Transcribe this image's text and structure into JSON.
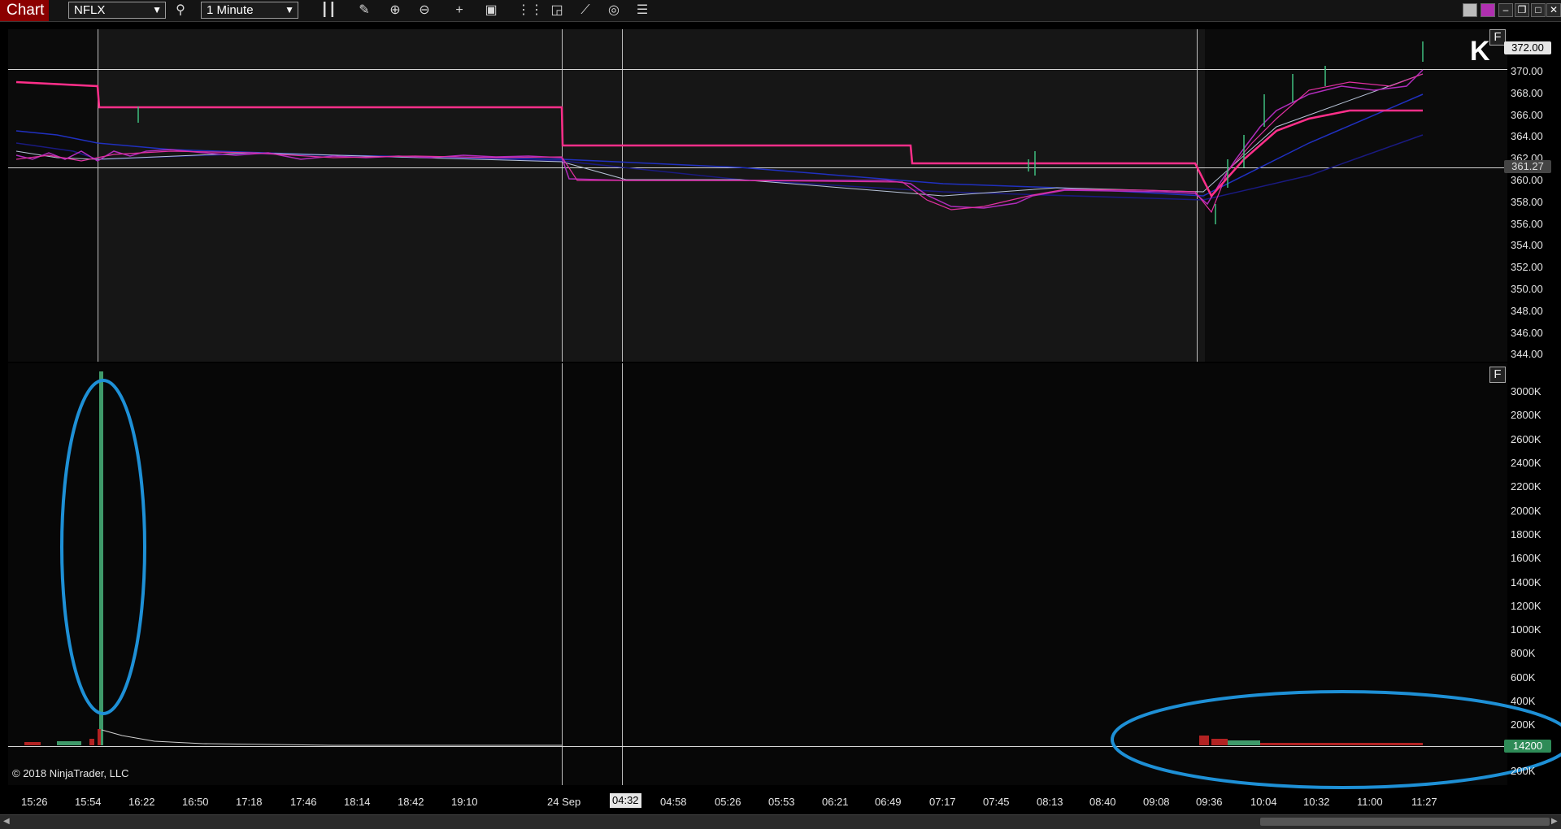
{
  "toolbar": {
    "app_title": "Chart",
    "instrument": "NFLX",
    "interval": "1 Minute",
    "icons": [
      "search-icon",
      "bar-chart-icon",
      "pencil-icon",
      "zoom-in-icon",
      "zoom-out-icon",
      "crosshair-icon",
      "properties-icon",
      "data-box-icon",
      "drawing-tools-icon",
      "strategy-icon",
      "indicator-icon",
      "menu-icon"
    ]
  },
  "window_controls": [
    "color-swatch-gray",
    "color-swatch-purple",
    "minimize",
    "restore",
    "maximize",
    "close"
  ],
  "panels": {
    "price": {
      "f_button": "F",
      "y_ticks": [
        "370.00",
        "368.00",
        "366.00",
        "364.00",
        "362.00",
        "360.00",
        "358.00",
        "356.00",
        "354.00",
        "352.00",
        "350.00",
        "348.00",
        "346.00",
        "344.00"
      ],
      "price_tag_top": "372.00",
      "price_tag_marker": "361.27",
      "logo": "K"
    },
    "volume": {
      "f_button": "F",
      "y_ticks": [
        "3000K",
        "2800K",
        "2600K",
        "2400K",
        "2200K",
        "2000K",
        "1800K",
        "1600K",
        "1400K",
        "1200K",
        "1000K",
        "800K",
        "600K",
        "400K",
        "200K",
        "200K"
      ],
      "current_volume": "14200",
      "copyright": "© 2018 NinjaTrader, LLC"
    }
  },
  "x_axis": {
    "labels": [
      "15:26",
      "15:54",
      "16:22",
      "16:50",
      "17:18",
      "17:46",
      "18:14",
      "18:42",
      "19:10",
      "24 Sep",
      "04:32",
      "04:58",
      "05:26",
      "05:53",
      "06:21",
      "06:49",
      "07:17",
      "07:45",
      "08:13",
      "08:40",
      "09:08",
      "09:36",
      "10:04",
      "10:32",
      "11:00",
      "11:27"
    ],
    "highlighted": "04:32"
  },
  "colors": {
    "annotation_ellipse": "#1e90d6",
    "pink_ma": "#ff2f8a",
    "up_volume": "#3f9a6a",
    "down_volume": "#b22222",
    "volume_tag": "#2e8b57"
  }
}
